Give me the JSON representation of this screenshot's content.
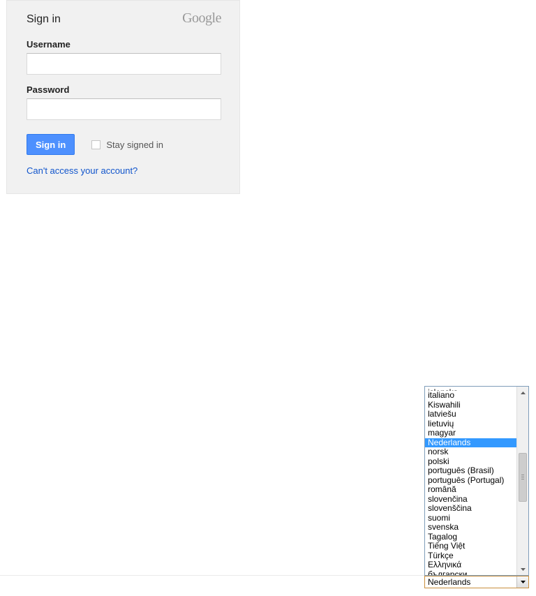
{
  "signin": {
    "title": "Sign in",
    "brand": "Google",
    "username_label": "Username",
    "password_label": "Password",
    "button_label": "Sign in",
    "stay_label": "Stay signed in",
    "cant_access": "Can't access your account?"
  },
  "language": {
    "selected": "Nederlands",
    "options": [
      "islenska",
      "italiano",
      "Kiswahili",
      "latviešu",
      "lietuvių",
      "magyar",
      "Nederlands",
      "norsk",
      "polski",
      "português (Brasil)",
      "português (Portugal)",
      "română",
      "slovenčina",
      "slovenščina",
      "suomi",
      "svenska",
      "Tagalog",
      "Tiếng Việt",
      "Türkçe",
      "Ελληνικά",
      "български"
    ]
  }
}
